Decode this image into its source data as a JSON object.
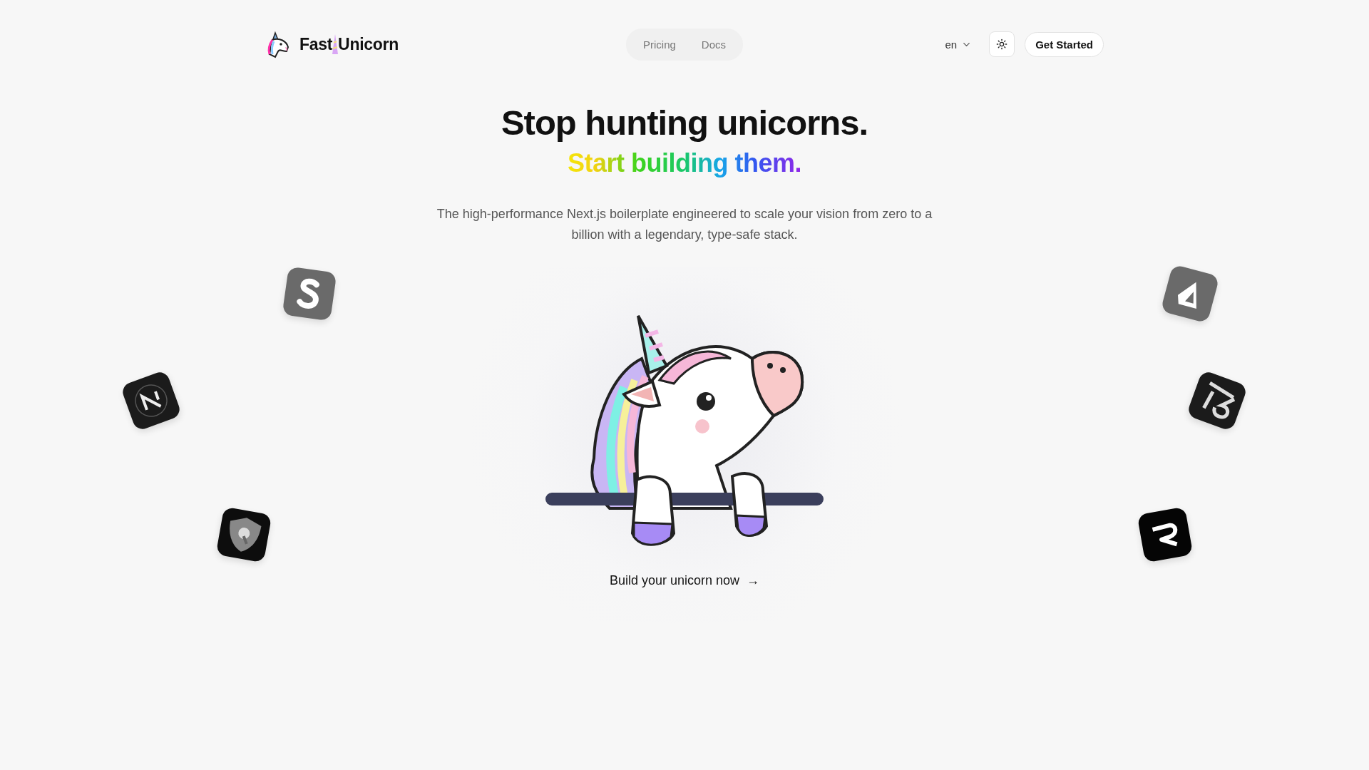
{
  "brand": {
    "words": [
      "Fast",
      "Unicorn"
    ]
  },
  "nav": {
    "links": [
      {
        "label": "Pricing"
      },
      {
        "label": "Docs"
      }
    ]
  },
  "language": {
    "value": "en"
  },
  "cta_header": {
    "label": "Get Started"
  },
  "hero": {
    "title": "Stop hunting unicorns.",
    "subtitle": "Start building them.",
    "description": "The high-performance Next.js boilerplate engineered to scale your vision from zero to a billion with a legendary, type-safe stack.",
    "cta": {
      "label": "Build your unicorn now",
      "arrow": "→"
    }
  }
}
